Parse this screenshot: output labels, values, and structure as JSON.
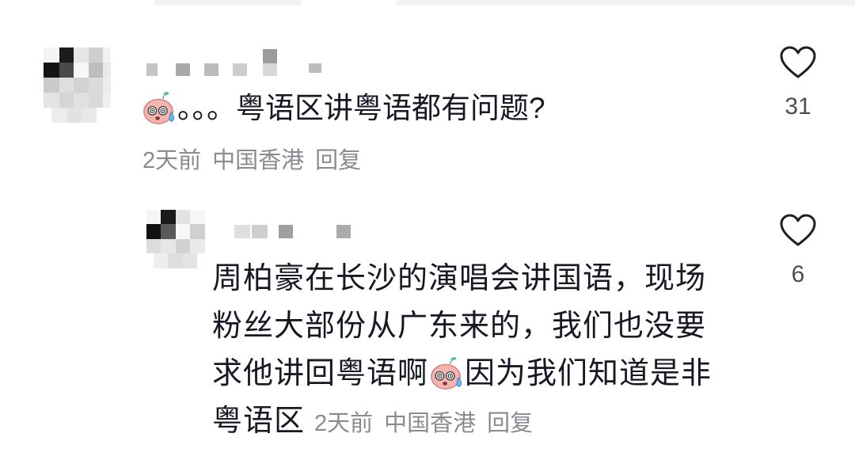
{
  "theme": {
    "text_color": "#161823",
    "meta_color": "#8a8b91",
    "icon_color": "#1f1f1f",
    "count_color": "#4d4d52"
  },
  "comments": [
    {
      "avatar": "pixelated-avatar",
      "emoji": "pink-sweat-face-emoji",
      "body": "。。。粤语区讲粤语都有问题?",
      "time": "2天前",
      "location": "中国香港",
      "reply_label": "回复",
      "like_icon": "heart-outline-icon",
      "like_count": "31"
    },
    {
      "avatar": "pixelated-avatar",
      "emoji": "pink-sweat-face-emoji",
      "body": [
        "周柏豪在长沙的演唱会讲国语，现场",
        "粉丝大部份从广东来的，我们也没要",
        "求他讲回粤语啊",
        "因为我们知道是非",
        "粤语区"
      ],
      "time": "2天前",
      "location": "中国香港",
      "reply_label": "回复",
      "like_icon": "heart-outline-icon",
      "like_count": "6"
    }
  ]
}
